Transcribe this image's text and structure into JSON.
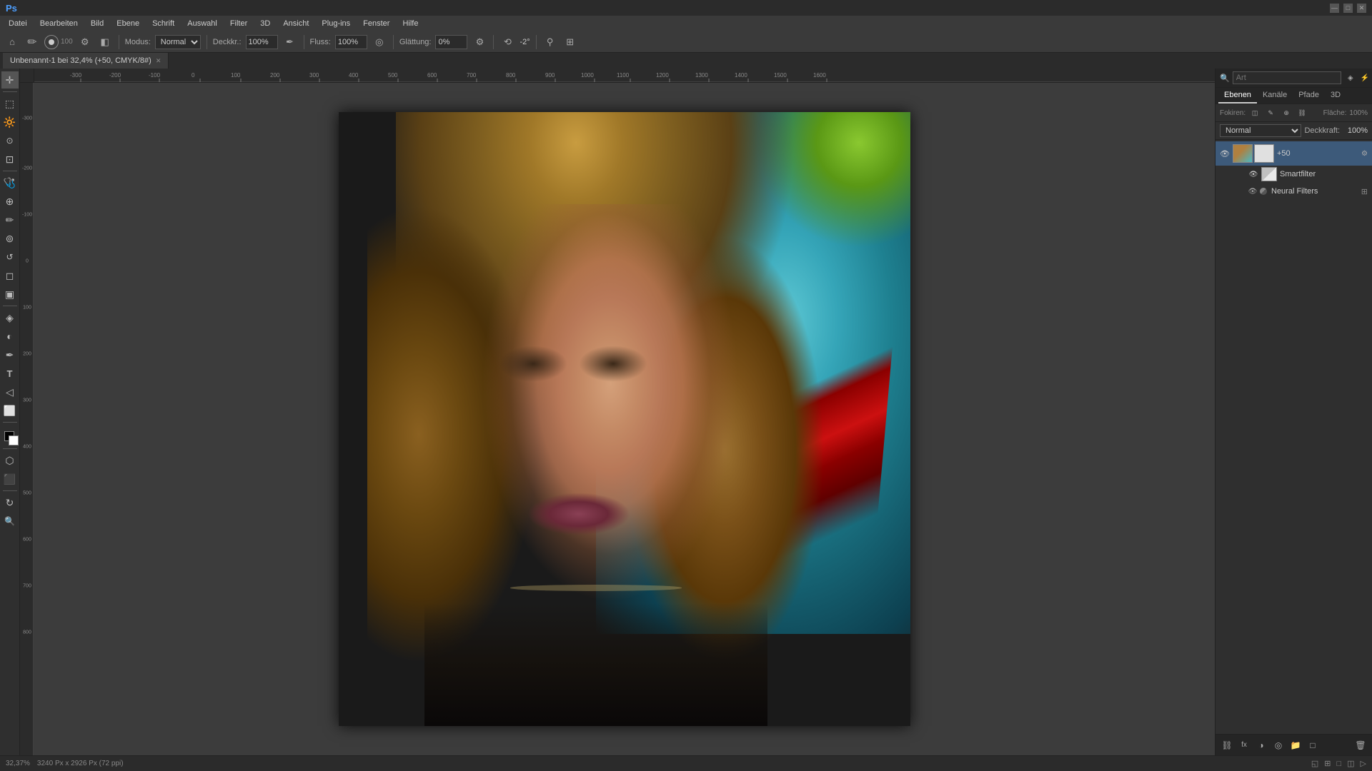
{
  "titlebar": {
    "app_name": "Adobe Photoshop",
    "controls": [
      "—",
      "□",
      "✕"
    ]
  },
  "menubar": {
    "items": [
      "Datei",
      "Bearbeiten",
      "Bild",
      "Ebene",
      "Schrift",
      "Auswahl",
      "Filter",
      "3D",
      "Ansicht",
      "Plug-ins",
      "Fenster",
      "Hilfe"
    ]
  },
  "optionsbar": {
    "modus_label": "Modus:",
    "modus_value": "Normal",
    "deckkraft_label": "Deckkr.:",
    "deckkraft_value": "100%",
    "fluss_label": "Fluss:",
    "fluss_value": "100%",
    "glaettung_label": "Glättung:",
    "glaettung_value": "0%",
    "winkel_value": "-2°"
  },
  "tab": {
    "title": "Unbenannt-1 bei 32,4% (+50, CMYK/8#)",
    "close": "✕"
  },
  "canvas": {
    "ruler_units": [
      "-300",
      "-200",
      "-100",
      "0",
      "100",
      "200",
      "300",
      "400",
      "500"
    ]
  },
  "panels": {
    "tabs": [
      "Ebenen",
      "Kanäle",
      "Pfade",
      "3D"
    ],
    "active_tab": "Ebenen"
  },
  "layer_panel": {
    "search_placeholder": "Art",
    "blend_mode": "Normal",
    "opacity_label": "Deckkraft:",
    "opacity_value": "100%",
    "fill_label": "Fläche:",
    "fill_value": "100%",
    "fokus_label": "Fokiren:",
    "layers": [
      {
        "id": "layer-main",
        "name": "+50",
        "visible": true,
        "type": "image",
        "active": true,
        "badge": "",
        "expanded": true
      },
      {
        "id": "layer-smartfilter",
        "name": "Smartfilter",
        "visible": true,
        "type": "filter-mask",
        "active": false,
        "sub": true
      },
      {
        "id": "layer-neural",
        "name": "Neural Filters",
        "visible": true,
        "type": "smart-filter",
        "active": false,
        "sub": true
      }
    ],
    "bottom_buttons": [
      "fx",
      "◑",
      "□",
      "🗑"
    ]
  },
  "statusbar": {
    "zoom": "32,37%",
    "dimensions": "3240 Px x 2926 Px (72 ppi)"
  }
}
